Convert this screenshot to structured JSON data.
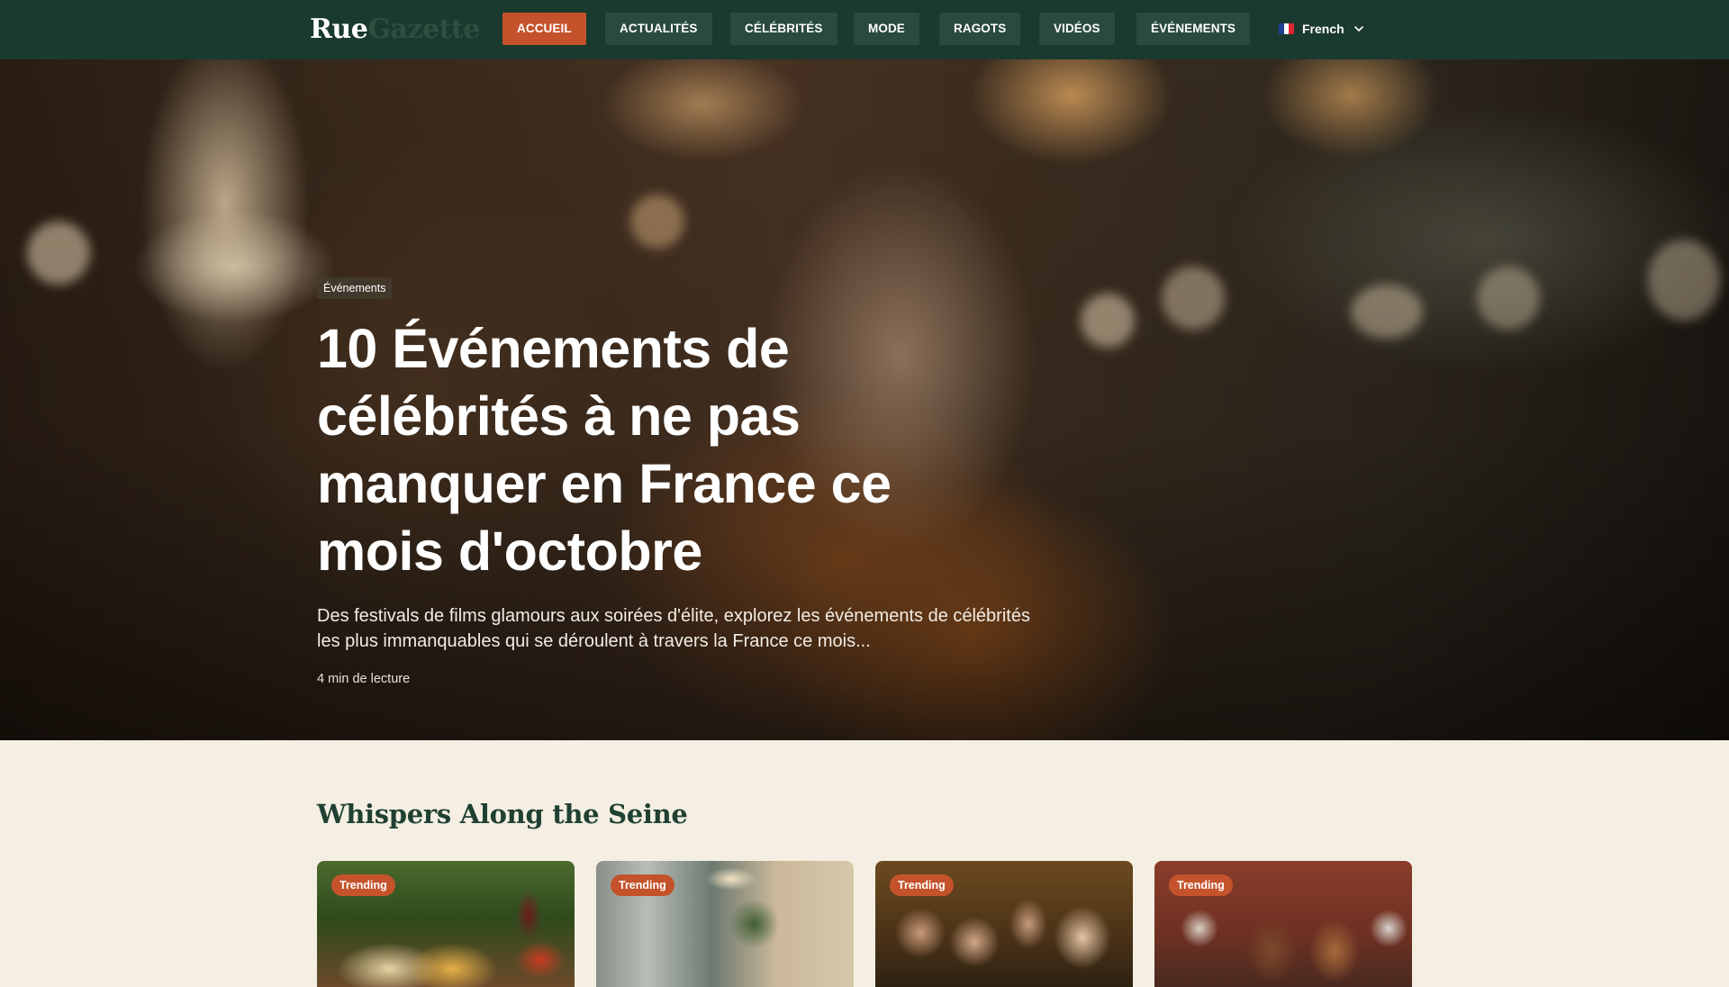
{
  "brand": {
    "name_part1": "Rue",
    "name_part2": "Gazette"
  },
  "nav": {
    "items": [
      {
        "label": "Accueil",
        "active": true
      },
      {
        "label": "Actualités"
      },
      {
        "label": "Célébrités"
      },
      {
        "label": "Mode"
      },
      {
        "label": "Ragots"
      },
      {
        "label": "Vidéos"
      },
      {
        "label": "Événements"
      }
    ],
    "language": {
      "label": "French",
      "flag_icon": "flag-fr-icon"
    }
  },
  "hero": {
    "category": "Événements",
    "title": "10 Événements de célébrités à ne pas manquer en France ce mois d'octobre",
    "subtitle": "Des festivals de films glamours aux soirées d'élite, explorez les événements de célébrités les plus immanquables qui se déroulent à travers la France ce mois...",
    "read_time": "4 min de lecture"
  },
  "section": {
    "title": "Whispers Along the Seine",
    "cards": [
      {
        "badge": "Trending"
      },
      {
        "badge": "Trending"
      },
      {
        "badge": "Trending"
      },
      {
        "badge": "Trending"
      }
    ]
  },
  "colors": {
    "nav_bg": "#1b3a2f",
    "nav_button_bg": "#2a4a3d",
    "accent": "#c4532c",
    "page_bg": "#f4efe2",
    "section_title": "#1f4033"
  }
}
